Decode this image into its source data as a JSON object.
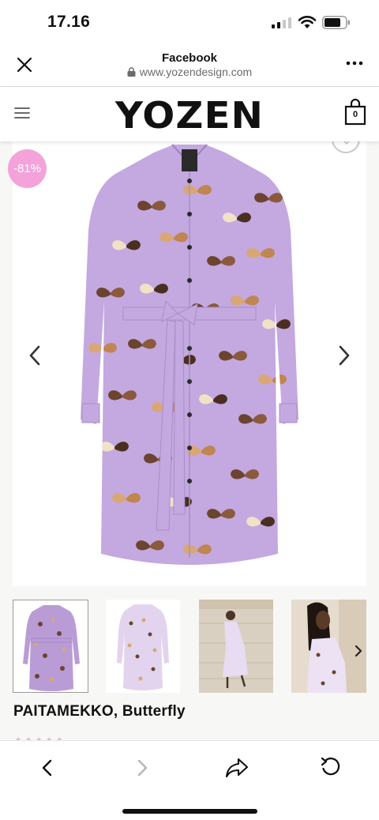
{
  "status_bar": {
    "time": "17.16"
  },
  "browser": {
    "site_title": "Facebook",
    "url": "www.yozendesign.com"
  },
  "site": {
    "logo_text": "YOZEN",
    "cart_count": "0"
  },
  "product": {
    "discount": "-81%",
    "title": "PAITAMEKKO, Butterfly",
    "thumbnails": [
      "thumbnail-front",
      "thumbnail-back",
      "thumbnail-model-steps",
      "thumbnail-model-portrait"
    ]
  },
  "colors": {
    "dress": "#c4a8e0",
    "badge": "#f3a3d9",
    "butterfly_dark": "#6b4430",
    "butterfly_light": "#d8a774",
    "butterfly_cream": "#f1e1c7"
  }
}
